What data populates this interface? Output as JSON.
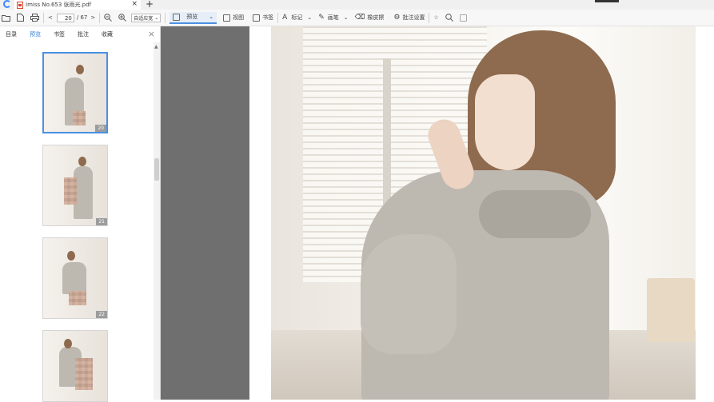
{
  "titlebar": {
    "tab_title": "Imiss No.653 张雨光.pdf",
    "tab_close": "×",
    "new_tab": "+"
  },
  "toolbar": {
    "prev": "<",
    "page_current": "20",
    "page_total": "/ 67",
    "next": ">",
    "zoom_mode": "自适应宽",
    "preview_label": "预览",
    "view_label": "视图",
    "bookmark_label": "书签",
    "mark_label": "标记",
    "pen_label": "画笔",
    "eraser_label": "橡皮擦",
    "annotate_settings_label": "批注设置"
  },
  "sidebar": {
    "tabs": [
      "目录",
      "预览",
      "书签",
      "批注",
      "收藏"
    ],
    "active_tab": "预览",
    "close": "×",
    "thumbnails": [
      {
        "page": "20",
        "selected": true
      },
      {
        "page": "21",
        "selected": false
      },
      {
        "page": "22",
        "selected": false
      },
      {
        "page": "",
        "selected": false
      }
    ]
  },
  "colors": {
    "accent": "#4a90e2",
    "doc_background": "#6f6f6f",
    "pdf_icon": "#d9442b"
  }
}
